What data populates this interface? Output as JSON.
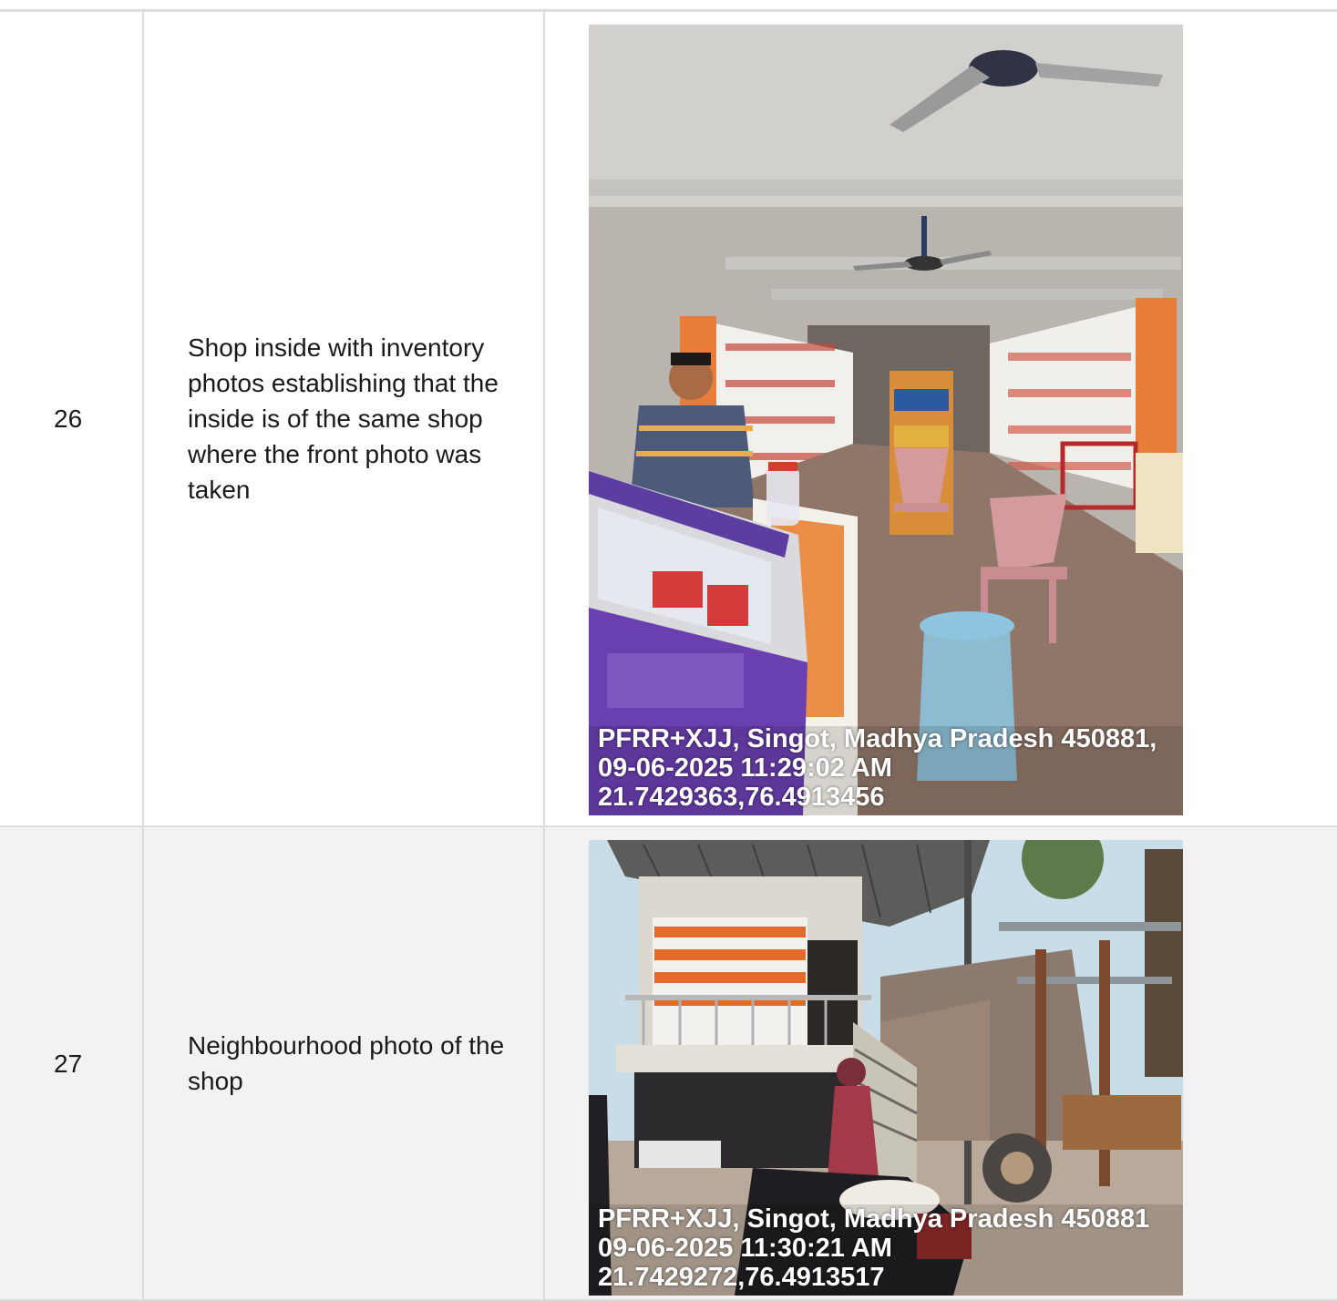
{
  "rows": [
    {
      "number": "26",
      "description": "Shop inside with inventory photos establishing that the inside is of the same shop where the front photo was taken",
      "photo": {
        "subject": "shop-interior-photo",
        "stamp_address": "PFRR+XJJ, Singot, Madhya Pradesh 450881,",
        "stamp_datetime": "09-06-2025 11:29:02 AM",
        "stamp_coords": "21.7429363,76.4913456"
      }
    },
    {
      "number": "27",
      "description": "Neighbourhood photo of the shop",
      "photo": {
        "subject": "shop-neighbourhood-photo",
        "stamp_address": "PFRR+XJJ, Singot, Madhya Pradesh 450881",
        "stamp_datetime": "09-06-2025 11:30:21 AM",
        "stamp_coords": "21.7429272,76.4913517"
      }
    }
  ]
}
